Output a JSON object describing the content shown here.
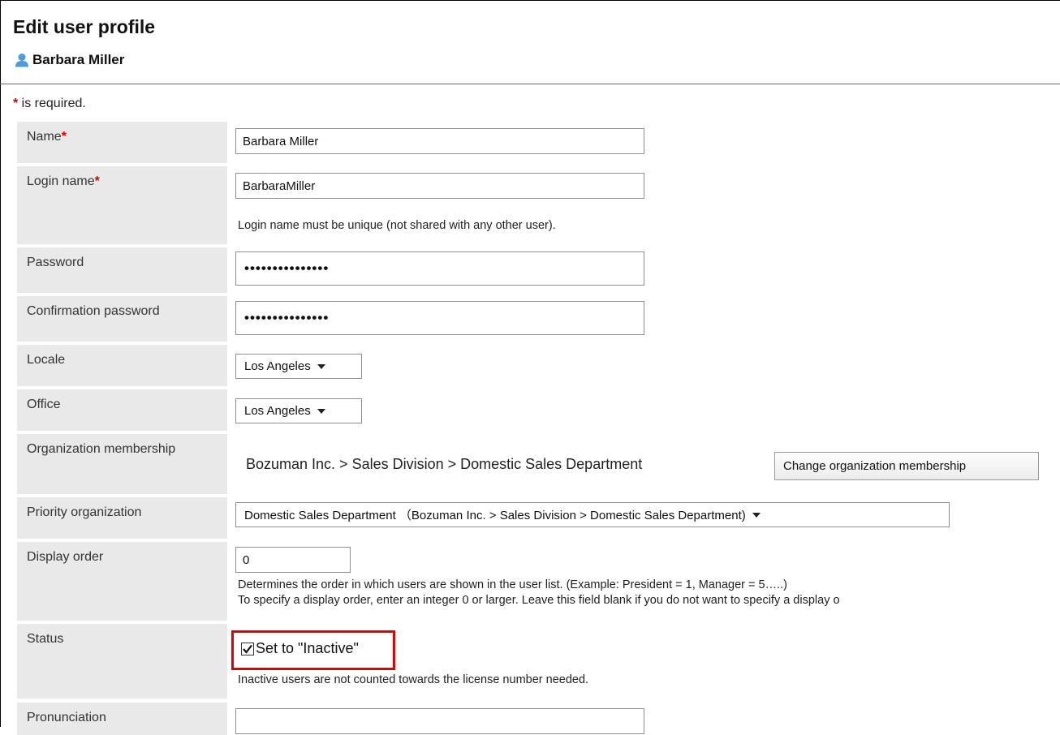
{
  "page": {
    "title": "Edit user profile",
    "user_name": "Barbara Miller",
    "required_note": " is required.",
    "required_star": "*"
  },
  "fields": {
    "name": {
      "label": "Name",
      "value": "Barbara Miller"
    },
    "login_name": {
      "label": "Login name",
      "value": "BarbaraMiller",
      "help": "Login name must be unique (not shared with any other user)."
    },
    "password": {
      "label": "Password",
      "masked": "•••••••••••••••"
    },
    "confirm_password": {
      "label": "Confirmation password",
      "masked": "•••••••••••••••"
    },
    "locale": {
      "label": "Locale",
      "selected": "Los Angeles"
    },
    "office": {
      "label": "Office",
      "selected": "Los Angeles"
    },
    "org_membership": {
      "label": "Organization membership",
      "path": "Bozuman Inc. > Sales Division > Domestic Sales Department",
      "button": "Change organization membership"
    },
    "priority_org": {
      "label": "Priority organization",
      "selected": "Domestic Sales Department （Bozuman Inc. > Sales Division > Domestic Sales Department)"
    },
    "display_order": {
      "label": "Display order",
      "value": "0",
      "help1": "Determines the order in which users are shown in the user list. (Example: President = 1, Manager = 5…..)",
      "help2": "To specify a display order, enter an integer 0 or larger. Leave this field blank if you do not want to specify a display o"
    },
    "status": {
      "label": "Status",
      "checkbox_label": "Set to \"Inactive\"",
      "checked": true,
      "help": "Inactive users are not counted towards the license number needed."
    },
    "pronunciation": {
      "label": "Pronunciation",
      "value": ""
    }
  },
  "colors": {
    "required": "#e00000",
    "label_bg": "#e9e9e9",
    "highlight": "#e00000"
  }
}
